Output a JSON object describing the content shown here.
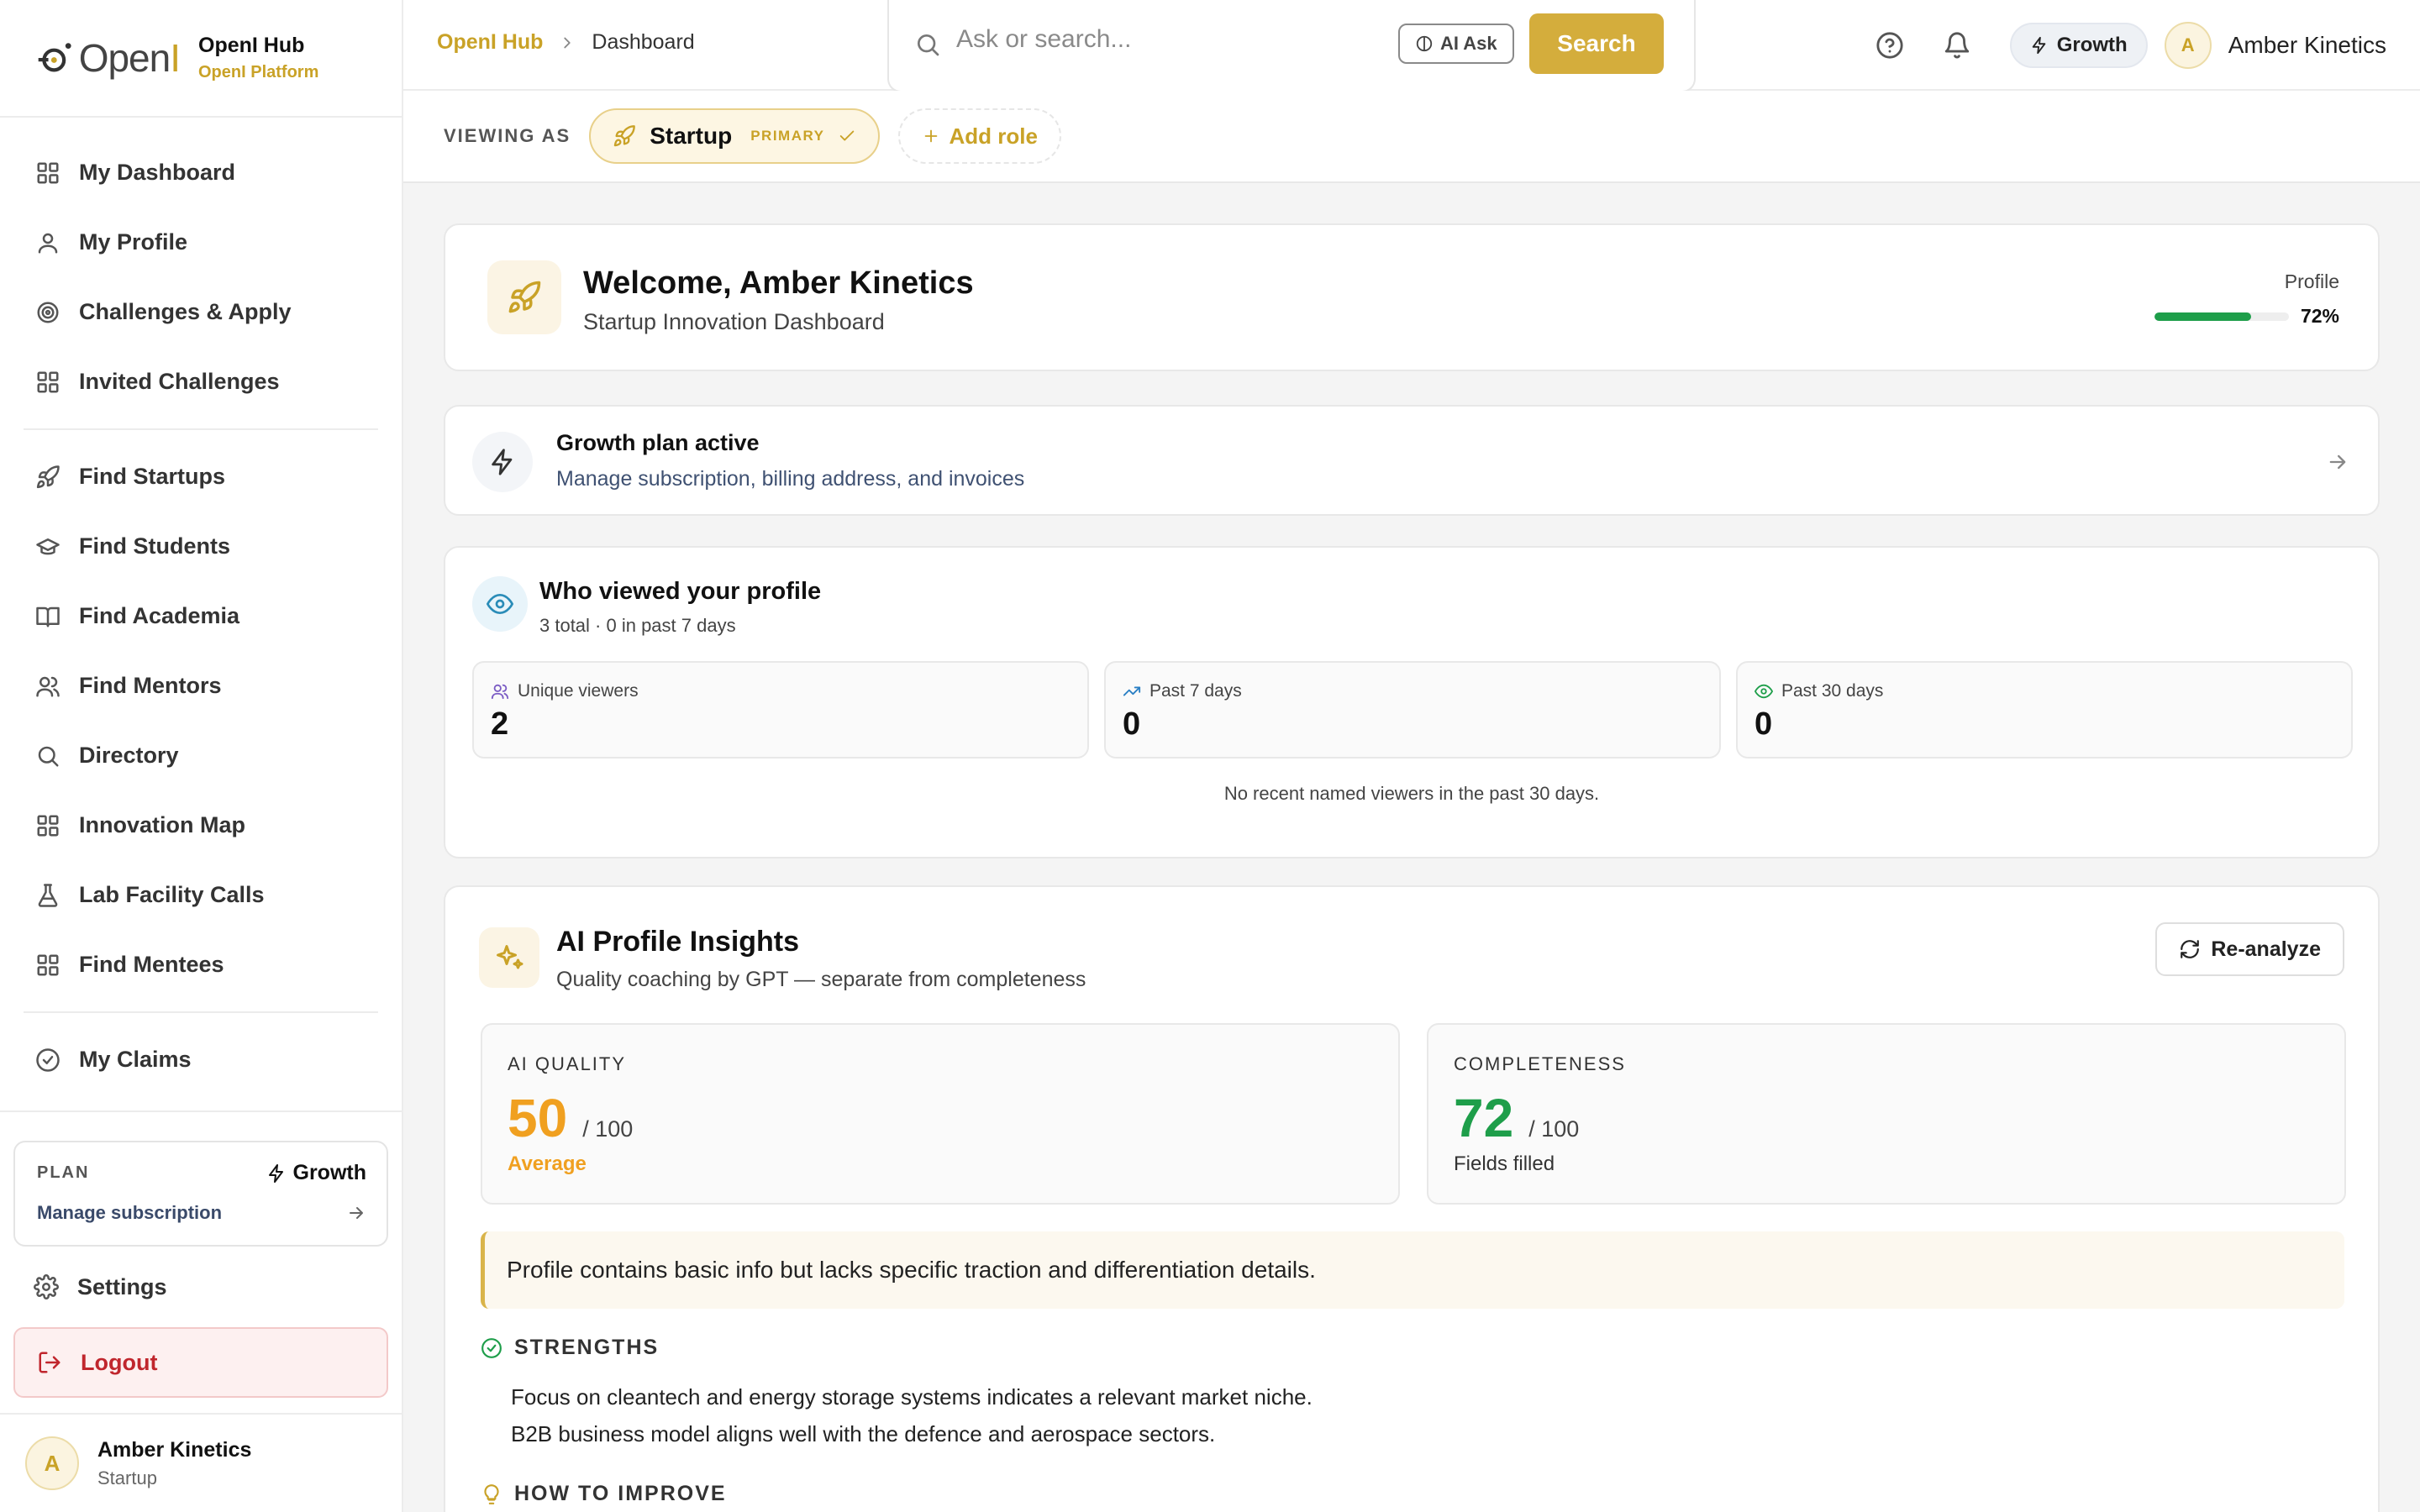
{
  "brand": {
    "title": "OpenI Hub",
    "subtitle": "OpenI Platform",
    "logo_text": "OpenI"
  },
  "sidebar": {
    "groups": [
      [
        {
          "label": "My Dashboard",
          "icon": "grid-icon"
        },
        {
          "label": "My Profile",
          "icon": "user-icon"
        },
        {
          "label": "Challenges & Apply",
          "icon": "target-icon"
        },
        {
          "label": "Invited Challenges",
          "icon": "grid-icon"
        }
      ],
      [
        {
          "label": "Find Startups",
          "icon": "rocket-icon"
        },
        {
          "label": "Find Students",
          "icon": "graduation-cap-icon"
        },
        {
          "label": "Find Academia",
          "icon": "book-icon"
        },
        {
          "label": "Find Mentors",
          "icon": "users-icon"
        },
        {
          "label": "Directory",
          "icon": "search-icon"
        },
        {
          "label": "Innovation Map",
          "icon": "grid-icon"
        },
        {
          "label": "Lab Facility Calls",
          "icon": "flask-icon"
        },
        {
          "label": "Find Mentees",
          "icon": "grid-icon"
        }
      ],
      [
        {
          "label": "My Claims",
          "icon": "check-circle-icon"
        }
      ]
    ],
    "plan": {
      "label": "PLAN",
      "name": "Growth",
      "manage": "Manage subscription"
    },
    "settings": "Settings",
    "logout": "Logout",
    "user": {
      "initial": "A",
      "name": "Amber Kinetics",
      "role": "Startup"
    }
  },
  "topbar": {
    "breadcrumb": [
      "OpenI Hub",
      "Dashboard"
    ],
    "search": {
      "placeholder": "Ask or search...",
      "ai_label": "AI Ask",
      "button": "Search"
    },
    "plan_badge": "Growth",
    "user": {
      "initial": "A",
      "name": "Amber Kinetics"
    }
  },
  "viewing": {
    "label": "VIEWING AS",
    "role": "Startup",
    "badge": "PRIMARY",
    "add": "Add role"
  },
  "welcome": {
    "title": "Welcome, Amber Kinetics",
    "subtitle": "Startup Innovation Dashboard",
    "profile_label": "Profile",
    "profile_pct": "72%",
    "profile_value": 0.72
  },
  "plan_card": {
    "title": "Growth plan active",
    "subtitle": "Manage subscription, billing address, and invoices"
  },
  "viewers": {
    "title": "Who viewed your profile",
    "subtitle": "3 total · 0 in past 7 days",
    "stats": [
      {
        "label": "Unique viewers",
        "value": "2",
        "icon": "users-icon",
        "color": "#7b5cc4"
      },
      {
        "label": "Past 7 days",
        "value": "0",
        "icon": "trending-up-icon",
        "color": "#2a7fc4"
      },
      {
        "label": "Past 30 days",
        "value": "0",
        "icon": "eye-icon",
        "color": "#1e9e4a"
      }
    ],
    "note": "No recent named viewers in the past 30 days."
  },
  "insights": {
    "title": "AI Profile Insights",
    "subtitle": "Quality coaching by GPT — separate from completeness",
    "reanalyze": "Re-analyze",
    "quality": {
      "label": "AI QUALITY",
      "value": "50",
      "of": "/ 100",
      "note": "Average",
      "color": "#f0a020"
    },
    "completeness": {
      "label": "COMPLETENESS",
      "value": "72",
      "of": "/ 100",
      "note": "Fields filled",
      "color": "#1e9e4a"
    },
    "summary": "Profile contains basic info but lacks specific traction and differentiation details.",
    "strengths_label": "STRENGTHS",
    "strengths": [
      "Focus on cleantech and energy storage systems indicates a relevant market niche.",
      "B2B business model aligns well with the defence and aerospace sectors."
    ],
    "improve_label": "HOW TO IMPROVE"
  },
  "colors": {
    "accent": "#c9a227",
    "success": "#1e9e4a",
    "danger": "#c0262d"
  }
}
